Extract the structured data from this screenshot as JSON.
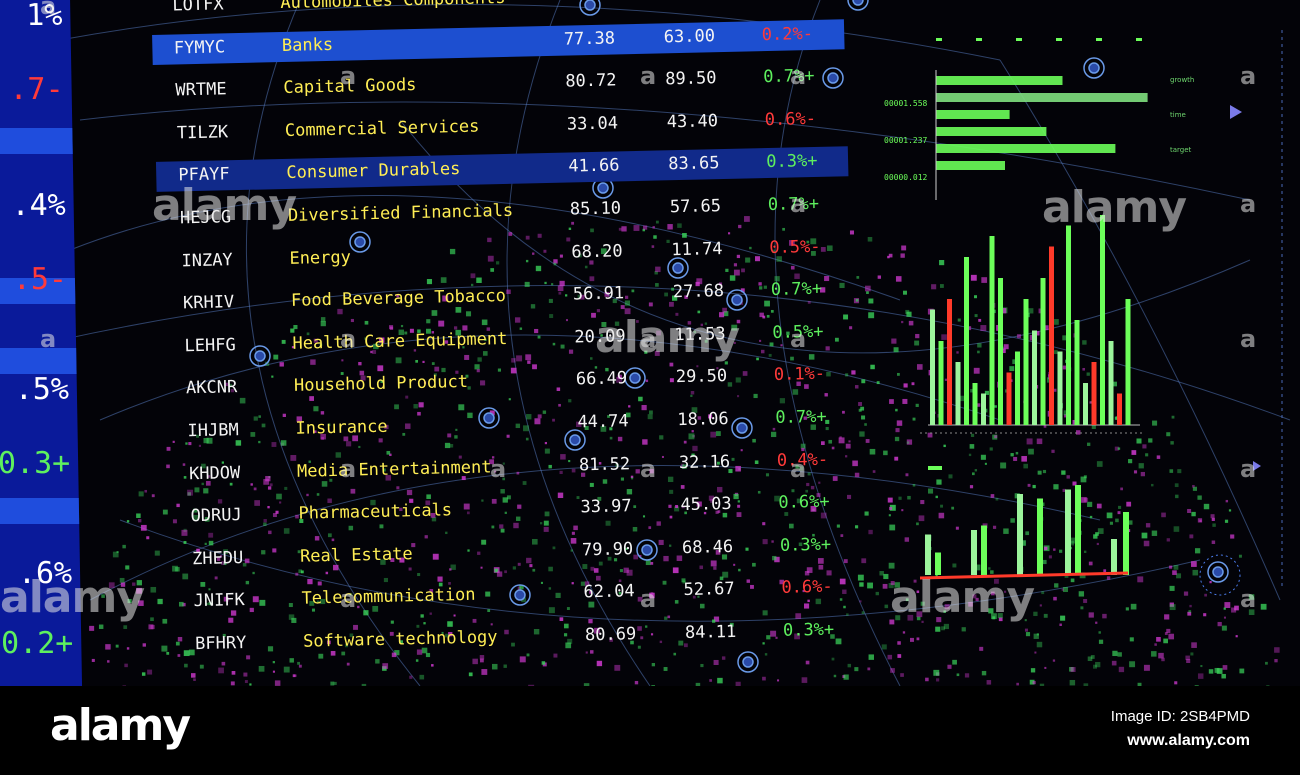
{
  "side_panel": {
    "values": [
      {
        "text": "1%",
        "color": "#ffffff"
      },
      {
        "text": ".7-",
        "color": "#ff3a3a"
      },
      {
        "text": ".4%",
        "color": "#ffffff"
      },
      {
        "text": ".5-",
        "color": "#ff3a3a"
      },
      {
        "text": ".5%",
        "color": "#ffffff"
      },
      {
        "text": "0.3+",
        "color": "#5ef05e"
      },
      {
        "text": ".6%",
        "color": "#ffffff"
      },
      {
        "text": "0.2+",
        "color": "#5ef05e"
      }
    ]
  },
  "table": {
    "rows": [
      {
        "symbol": "LOTFX",
        "name": "Automobiles Components",
        "a": "",
        "b": "",
        "change": "",
        "dir": "up",
        "highlight": ""
      },
      {
        "symbol": "FYMYC",
        "name": "Banks",
        "a": "77.38",
        "b": "63.00",
        "change": "0.2%-",
        "dir": "down",
        "highlight": "hl-1"
      },
      {
        "symbol": "WRTME",
        "name": "Capital Goods",
        "a": "80.72",
        "b": "89.50",
        "change": "0.7%+",
        "dir": "up",
        "highlight": ""
      },
      {
        "symbol": "TILZK",
        "name": "Commercial Services",
        "a": "33.04",
        "b": "43.40",
        "change": "0.6%-",
        "dir": "down",
        "highlight": ""
      },
      {
        "symbol": "PFAYF",
        "name": "Consumer Durables",
        "a": "41.66",
        "b": "83.65",
        "change": "0.3%+",
        "dir": "up",
        "highlight": "hl-2"
      },
      {
        "symbol": "HEJCG",
        "name": "Diversified Financials",
        "a": "85.10",
        "b": "57.65",
        "change": "0.7%+",
        "dir": "up",
        "highlight": ""
      },
      {
        "symbol": "INZAY",
        "name": "Energy",
        "a": "68.20",
        "b": "11.74",
        "change": "0.5%-",
        "dir": "down",
        "highlight": ""
      },
      {
        "symbol": "KRHIV",
        "name": "Food Beverage Tobacco",
        "a": "56.91",
        "b": "27.68",
        "change": "0.7%+",
        "dir": "up",
        "highlight": ""
      },
      {
        "symbol": "LEHFG",
        "name": "Health Care Equipment",
        "a": "20.09",
        "b": "11.53",
        "change": "0.5%+",
        "dir": "up",
        "highlight": ""
      },
      {
        "symbol": "AKCNR",
        "name": "Household Product",
        "a": "66.49",
        "b": "29.50",
        "change": "0.1%-",
        "dir": "down",
        "highlight": ""
      },
      {
        "symbol": "IHJBM",
        "name": "Insurance",
        "a": "44.74",
        "b": "18.06",
        "change": "0.7%+",
        "dir": "up",
        "highlight": ""
      },
      {
        "symbol": "KHDOW",
        "name": "Media Entertainment",
        "a": "81.52",
        "b": "32.16",
        "change": "0.4%-",
        "dir": "down",
        "highlight": ""
      },
      {
        "symbol": "ODRUJ",
        "name": "Pharmaceuticals",
        "a": "33.97",
        "b": "45.03",
        "change": "0.6%+",
        "dir": "up",
        "highlight": ""
      },
      {
        "symbol": "ZHEDU",
        "name": "Real Estate",
        "a": "79.90",
        "b": "68.46",
        "change": "0.3%+",
        "dir": "up",
        "highlight": ""
      },
      {
        "symbol": "JNIFK",
        "name": "Telecommunication",
        "a": "62.04",
        "b": "52.67",
        "change": "0.6%-",
        "dir": "down",
        "highlight": ""
      },
      {
        "symbol": "BFHRY",
        "name": "Software technology",
        "a": "80.69",
        "b": "84.11",
        "change": "0.3%+",
        "dir": "up",
        "highlight": ""
      }
    ]
  },
  "mini_charts": {
    "hbar_labels": [
      "00001.558",
      "00001.237",
      "00000.012"
    ],
    "hbar_side_labels": [
      "growth",
      "time",
      "target"
    ],
    "hbar_values": [
      0.55,
      0.92,
      0.32,
      0.48,
      0.78,
      0.3
    ],
    "vbar_values": [
      0.55,
      0.4,
      0.6,
      0.3,
      0.8,
      0.2,
      0.15,
      0.9,
      0.7,
      0.25,
      0.35,
      0.6,
      0.45,
      0.7,
      0.85,
      0.35,
      0.95,
      0.5,
      0.2,
      0.3,
      1.0,
      0.4,
      0.15,
      0.6
    ],
    "vbar_red_indices": [
      2,
      9,
      14,
      19,
      22
    ],
    "bottom_bar_values": [
      0.45,
      0.25,
      0.5,
      0.55,
      0.9,
      0.85,
      0.95,
      1.0,
      0.4,
      0.7
    ],
    "colors": {
      "green": "#6cff5a",
      "green2": "#9cf59c",
      "red": "#ff3a2a",
      "dim": "#3a8a3a"
    }
  },
  "watermarks": {
    "brand": "alamy",
    "glyph": "a"
  },
  "footer": {
    "logo": "alamy",
    "image_id": "Image ID: 2SB4PMD",
    "url": "www.alamy.com"
  }
}
